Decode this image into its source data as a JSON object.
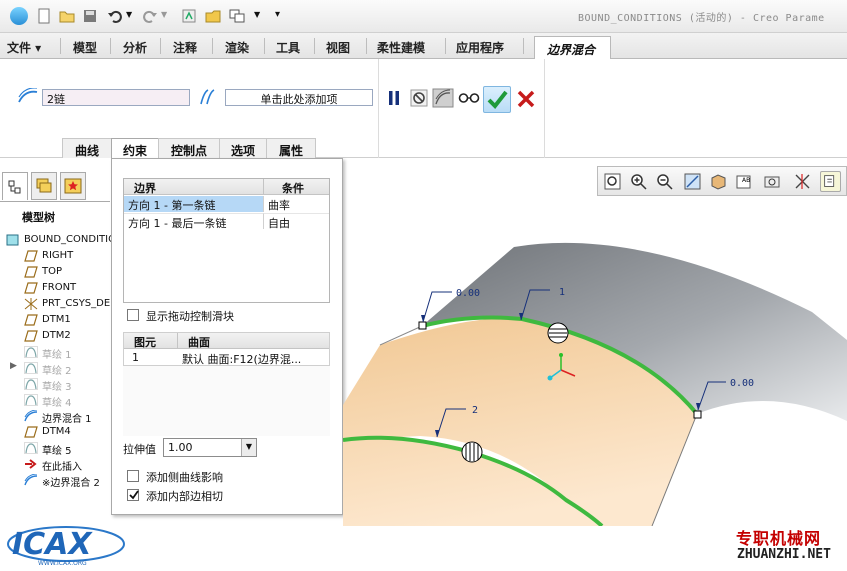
{
  "app": {
    "title": "BOUND_CONDITIONS (活动的) - Creo Parame"
  },
  "ribbon": {
    "tabs": [
      "文件 ▾",
      "模型",
      "分析",
      "注释",
      "渲染",
      "工具",
      "视图",
      "柔性建模",
      "应用程序"
    ],
    "active_tab": "边界混合"
  },
  "dashboard": {
    "first_direction_value": "2链",
    "second_direction_placeholder": "单击此处添加项",
    "subtabs": [
      "曲线",
      "约束",
      "控制点",
      "选项",
      "属性"
    ],
    "active_subtab": "约束"
  },
  "navigator": {
    "title": "模型树",
    "items": [
      {
        "label": "BOUND_CONDITION",
        "icon": "part-icon",
        "disabled": false
      },
      {
        "label": "RIGHT",
        "icon": "datum-plane-icon",
        "disabled": false
      },
      {
        "label": "TOP",
        "icon": "datum-plane-icon",
        "disabled": false
      },
      {
        "label": "FRONT",
        "icon": "datum-plane-icon",
        "disabled": false
      },
      {
        "label": "PRT_CSYS_DE",
        "icon": "csys-icon",
        "disabled": false
      },
      {
        "label": "DTM1",
        "icon": "datum-plane-icon",
        "disabled": false
      },
      {
        "label": "DTM2",
        "icon": "datum-plane-icon",
        "disabled": false
      },
      {
        "label": "草绘 1",
        "icon": "sketch-icon",
        "disabled": true
      },
      {
        "label": "草绘 2",
        "icon": "sketch-icon",
        "disabled": true
      },
      {
        "label": "草绘 3",
        "icon": "sketch-icon",
        "disabled": true
      },
      {
        "label": "草绘 4",
        "icon": "sketch-icon",
        "disabled": true
      },
      {
        "label": "边界混合 1",
        "icon": "boundary-blend-icon",
        "disabled": false
      },
      {
        "label": "DTM4",
        "icon": "datum-plane-icon",
        "disabled": false
      },
      {
        "label": "草绘 5",
        "icon": "sketch-icon",
        "disabled": false
      },
      {
        "label": "在此插入",
        "icon": "insert-arrow-icon",
        "disabled": false
      },
      {
        "label": "※边界混合 2",
        "icon": "boundary-blend-icon",
        "disabled": false
      }
    ]
  },
  "constraints_panel": {
    "boundary_table": {
      "headers": [
        "边界",
        "条件"
      ],
      "rows": [
        {
          "boundary": "方向 1 - 第一条链",
          "condition": "曲率",
          "selected": true
        },
        {
          "boundary": "方向 1 - 最后一条链",
          "condition": "自由",
          "selected": false
        }
      ]
    },
    "show_drag_handles_label": "显示拖动控制滑块",
    "show_drag_handles_checked": false,
    "element_table": {
      "headers": [
        "图元",
        "曲面"
      ],
      "rows": [
        {
          "element": "1",
          "surface": "默认 曲面:F12(边界混..."
        }
      ]
    },
    "stretch_label": "拉伸值",
    "stretch_value": "1.00",
    "add_side_curve_label": "添加侧曲线影响",
    "add_side_curve_checked": false,
    "add_inner_edge_label": "添加内部边相切",
    "add_inner_edge_checked": true
  },
  "viewport": {
    "callouts": [
      "0.00",
      "1",
      "0.00",
      "2"
    ],
    "surface_color": "#f3c99a",
    "ref_surface_color": "#9a9fa4",
    "chain_color": "#3fb93f"
  },
  "watermarks": {
    "left_logo": "ICAX",
    "left_sub": "WWW.ICAX.ORG",
    "right_cn": "专职机械网",
    "right_en": "ZHUANZHI.NET"
  }
}
